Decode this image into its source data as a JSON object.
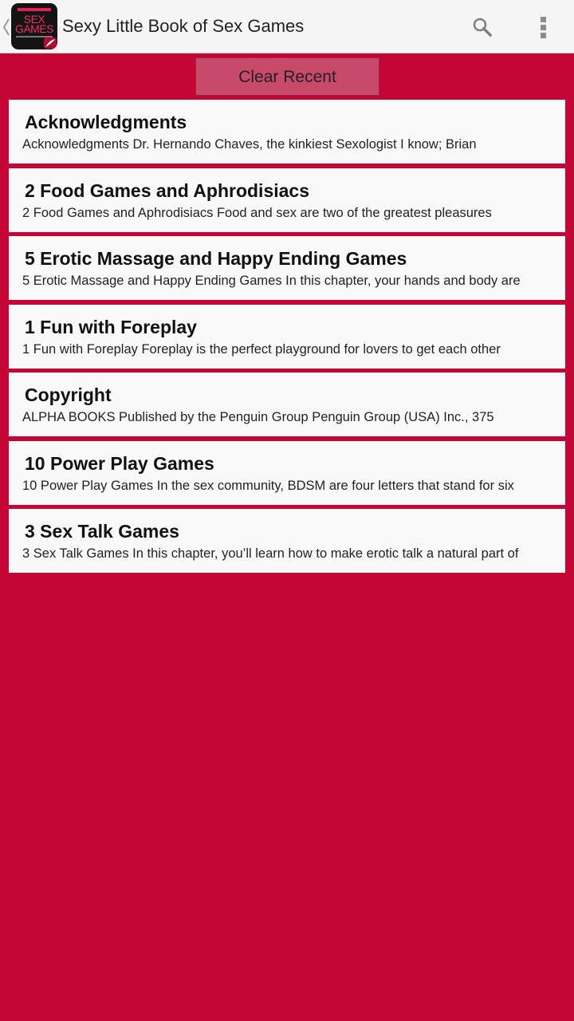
{
  "actionbar": {
    "title": "Sexy Little Book of Sex Games",
    "icon_lines": [
      "SEX",
      "GAMES"
    ],
    "search_icon": "search-icon",
    "overflow_icon": "overflow-menu-icon"
  },
  "clear_recent_label": "Clear Recent",
  "items": [
    {
      "title": "Acknowledgments",
      "snippet": "Acknowledgments Dr. Hernando Chaves, the kinkiest Sexologist I know; Brian"
    },
    {
      "title": "2 Food Games and Aphrodisiacs",
      "snippet": "2 Food Games and Aphrodisiacs Food and sex are two of the greatest pleasures"
    },
    {
      "title": "5 Erotic Massage and Happy Ending Games",
      "snippet": "5 Erotic Massage and Happy Ending Games In this chapter, your hands and body are"
    },
    {
      "title": "1 Fun with Foreplay",
      "snippet": "1 Fun with Foreplay Foreplay is the perfect playground for lovers to get each other"
    },
    {
      "title": "Copyright",
      "snippet": "ALPHA BOOKS Published by the Penguin Group Penguin Group (USA) Inc., 375"
    },
    {
      "title": "10 Power Play Games",
      "snippet": "10 Power Play Games In the sex community, BDSM are four letters that stand for six"
    },
    {
      "title": "3 Sex Talk Games",
      "snippet": "3 Sex Talk Games In this chapter, you’ll learn how to make erotic talk a natural part of"
    }
  ],
  "colors": {
    "background": "#c40637",
    "actionbar": "#f5f5f5",
    "card": "#f9f9f9",
    "button": "#c84a6a"
  }
}
